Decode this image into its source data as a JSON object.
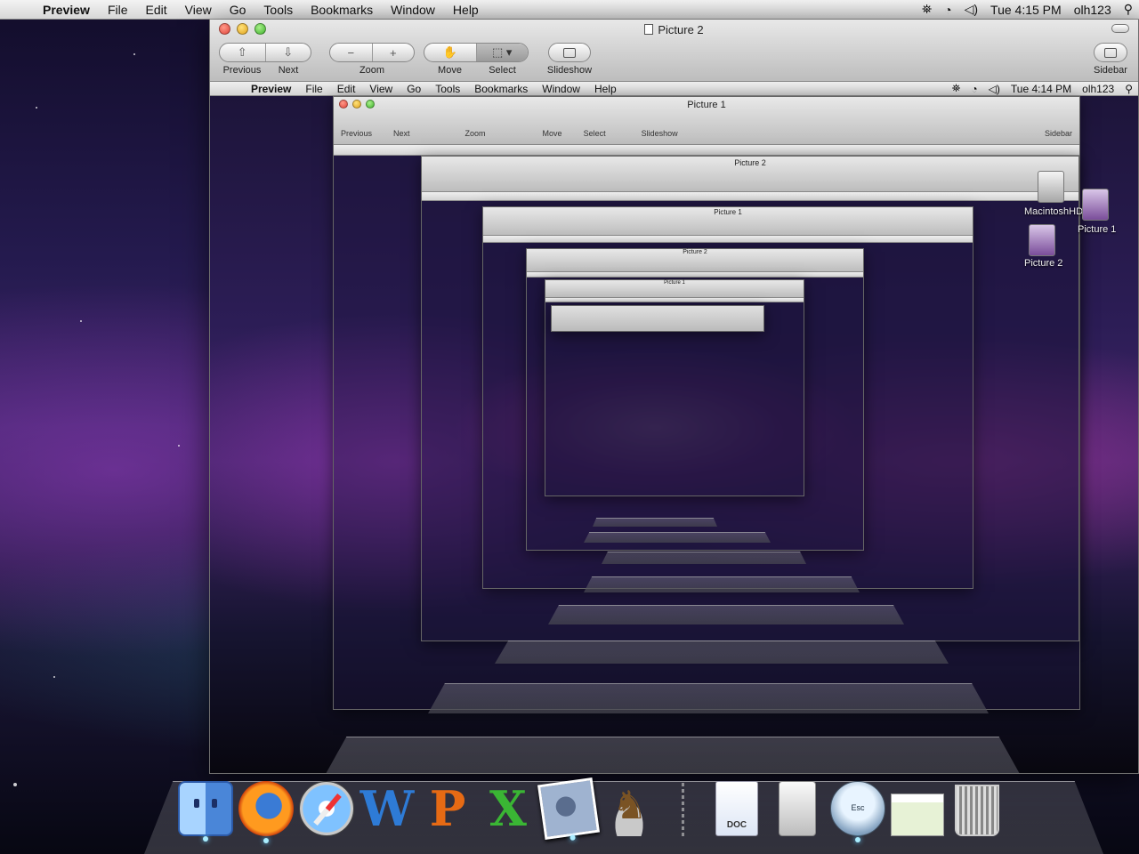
{
  "menubar": {
    "app": "Preview",
    "items": [
      "File",
      "Edit",
      "View",
      "Go",
      "Tools",
      "Bookmarks",
      "Window",
      "Help"
    ],
    "clock": "Tue 4:15 PM",
    "user": "olh123"
  },
  "window": {
    "title": "Picture 2",
    "toolbar": {
      "previous": "Previous",
      "next": "Next",
      "zoom": "Zoom",
      "move": "Move",
      "select": "Select",
      "slideshow": "Slideshow",
      "sidebar": "Sidebar"
    }
  },
  "inner": {
    "menubar": {
      "app": "Preview",
      "items": [
        "File",
        "Edit",
        "View",
        "Go",
        "Tools",
        "Bookmarks",
        "Window",
        "Help"
      ],
      "clock": "Tue 4:14 PM",
      "user": "olh123"
    },
    "window_title": "Picture 1",
    "toolbar": {
      "previous": "Previous",
      "next": "Next",
      "zoom": "Zoom",
      "move": "Move",
      "select": "Select",
      "slideshow": "Slideshow",
      "sidebar": "Sidebar"
    },
    "nested_titles": [
      "Picture 2",
      "Picture 1",
      "Picture 2",
      "Picture 1"
    ],
    "desktop_labels": {
      "drive": "MacintoshHD",
      "picture1": "Picture 1",
      "picture2": "Picture 2"
    }
  },
  "dock": {
    "apps": [
      "finder-icon",
      "firefox-icon",
      "safari-icon",
      "word-icon",
      "powerpoint-icon",
      "excel-icon",
      "iphoto-icon",
      "chess-icon"
    ],
    "docs": [
      "doc-file-icon",
      "disk-utility-icon",
      "esc-icon",
      "screenshot-icon",
      "trash-icon"
    ],
    "doc_label": "DOC",
    "esc_label": "Esc"
  }
}
